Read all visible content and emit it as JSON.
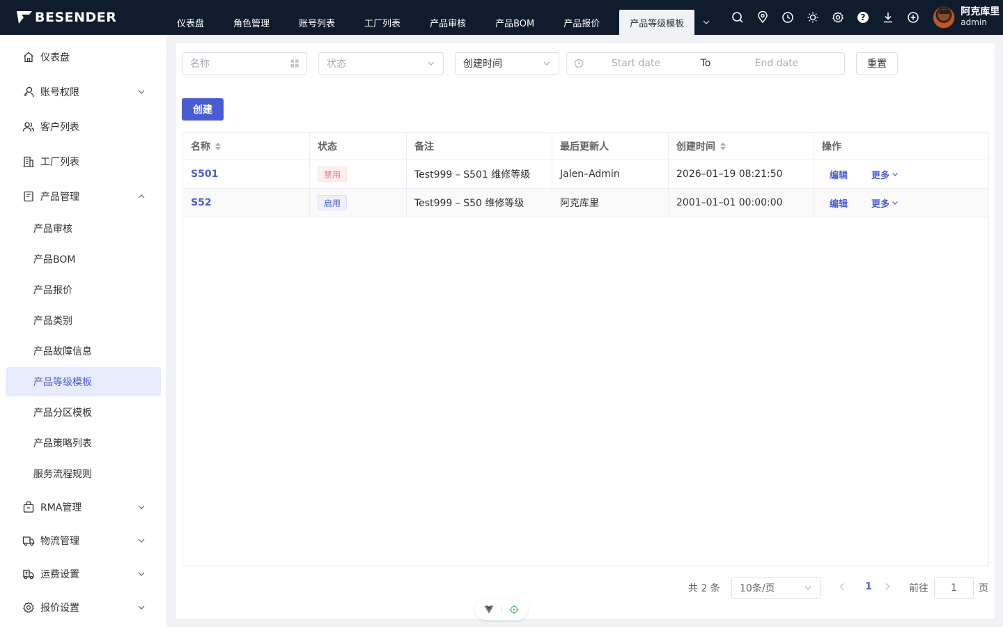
{
  "brand": {
    "name": "BESENDER"
  },
  "topnav": {
    "tabs": [
      {
        "label": "仪表盘"
      },
      {
        "label": "角色管理"
      },
      {
        "label": "账号列表"
      },
      {
        "label": "工厂列表"
      },
      {
        "label": "产品审核"
      },
      {
        "label": "产品BOM"
      },
      {
        "label": "产品报价"
      },
      {
        "label": "产品等级模板",
        "active": true
      }
    ],
    "icons": [
      "search-icon",
      "location-icon",
      "clock-icon",
      "sun-icon",
      "gear-icon",
      "help-icon",
      "download-icon",
      "plus-circle-icon"
    ],
    "user": {
      "name": "阿克库里",
      "role": "admin"
    }
  },
  "sidebar": {
    "items": [
      {
        "label": "仪表盘",
        "icon": "home-icon"
      },
      {
        "label": "账号权限",
        "icon": "key-user-icon",
        "expandable": true
      },
      {
        "label": "客户列表",
        "icon": "users-icon"
      },
      {
        "label": "工厂列表",
        "icon": "building-icon"
      },
      {
        "label": "产品管理",
        "icon": "product-icon",
        "expandable": true,
        "expanded": true
      },
      {
        "label": "RMA管理",
        "icon": "bag-icon",
        "expandable": true
      },
      {
        "label": "物流管理",
        "icon": "truck-icon",
        "expandable": true
      },
      {
        "label": "运费设置",
        "icon": "freight-icon",
        "expandable": true
      },
      {
        "label": "报价设置",
        "icon": "settings-icon",
        "expandable": true
      }
    ],
    "subitems": [
      {
        "label": "产品审核"
      },
      {
        "label": "产品BOM"
      },
      {
        "label": "产品报价"
      },
      {
        "label": "产品类别"
      },
      {
        "label": "产品故障信息"
      },
      {
        "label": "产品等级模板",
        "active": true
      },
      {
        "label": "产品分区模板"
      },
      {
        "label": "产品策略列表"
      },
      {
        "label": "服务流程规则"
      }
    ]
  },
  "filters": {
    "name_placeholder": "名称",
    "status_placeholder": "状态",
    "date_type": "创建时间",
    "start_placeholder": "Start date",
    "range_separator": "To",
    "end_placeholder": "End date",
    "reset_label": "重置"
  },
  "create_label": "创建",
  "table": {
    "columns": [
      "名称",
      "状态",
      "备注",
      "最后更新人",
      "创建时间",
      "操作"
    ],
    "rows": [
      {
        "name": "S501",
        "status": "禁用",
        "status_color": "#f56c6c",
        "remark": "Test999 – S501 维修等级",
        "updater": "Jalen–Admin",
        "created": "2026–01–19 08:21:50",
        "edit": "编辑",
        "more": "更多"
      },
      {
        "name": "S52",
        "status": "启用",
        "status_color": "#4a5bd6",
        "remark": "Test999 – S50 维修等级",
        "updater": "阿克库里",
        "created": "2001–01–01 00:00:00",
        "edit": "编辑",
        "more": "更多"
      }
    ]
  },
  "pagination": {
    "total_text": "共 2 条",
    "page_size": "10条/页",
    "current_page": "1",
    "goto_label": "前往",
    "goto_value": "1",
    "page_suffix": "页"
  },
  "colors": {
    "accent": "#4a5bd6",
    "topbar": "#0f1c2e"
  }
}
